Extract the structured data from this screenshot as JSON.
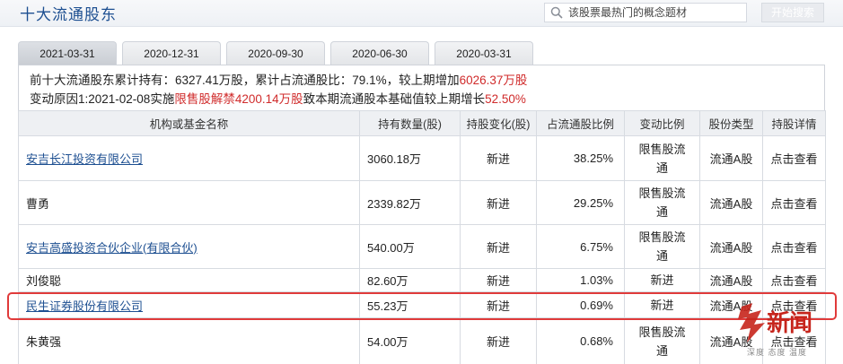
{
  "header": {
    "title": "十大流通股东",
    "search_placeholder": "该股票最热门的概念题材",
    "search_button": "开始搜索"
  },
  "tabs": [
    {
      "label": "2021-03-31",
      "active": true
    },
    {
      "label": "2020-12-31",
      "active": false
    },
    {
      "label": "2020-09-30",
      "active": false
    },
    {
      "label": "2020-06-30",
      "active": false
    },
    {
      "label": "2020-03-31",
      "active": false
    }
  ],
  "summary": {
    "line1_prefix": "前十大流通股东累计持有：6327.41万股，累计占流通股比：79.1%，较上期增加",
    "line1_value": "6026.37万股",
    "line2_prefix": "变动原因1:2021-02-08实施",
    "line2_red1": "限售股解禁4200.14万股",
    "line2_mid": "致本期流通股本基础值较上期增长",
    "line2_red2": "52.50%"
  },
  "table": {
    "headers": [
      "机构或基金名称",
      "持有数量(股)",
      "持股变化(股)",
      "占流通股比例",
      "变动比例",
      "股份类型",
      "持股详情"
    ],
    "rows": [
      {
        "name": "安吉长江投资有限公司",
        "link": true,
        "amount": "3060.18万",
        "change": "新进",
        "ratio": "38.25%",
        "reason": "限售股流通",
        "type": "流通A股",
        "detail": "点击查看"
      },
      {
        "name": "曹勇",
        "link": false,
        "amount": "2339.82万",
        "change": "新进",
        "ratio": "29.25%",
        "reason": "限售股流通",
        "type": "流通A股",
        "detail": "点击查看"
      },
      {
        "name": "安吉高盛投资合伙企业(有限合伙)",
        "link": true,
        "amount": "540.00万",
        "change": "新进",
        "ratio": "6.75%",
        "reason": "限售股流通",
        "type": "流通A股",
        "detail": "点击查看"
      },
      {
        "name": "刘俊聪",
        "link": false,
        "amount": "82.60万",
        "change": "新进",
        "ratio": "1.03%",
        "reason": "新进",
        "type": "流通A股",
        "detail": "点击查看"
      },
      {
        "name": "民生证券股份有限公司",
        "link": true,
        "amount": "55.23万",
        "change": "新进",
        "ratio": "0.69%",
        "reason": "新进",
        "type": "流通A股",
        "detail": "点击查看"
      },
      {
        "name": "朱黄强",
        "link": false,
        "amount": "54.00万",
        "change": "新进",
        "ratio": "0.68%",
        "reason": "限售股流通",
        "type": "流通A股",
        "detail": "点击查看"
      }
    ]
  },
  "watermark": {
    "text": "新闻",
    "sub": "深度 态度 温度"
  },
  "colors": {
    "accent_red": "#d02b2b",
    "link_blue": "#1d4f91",
    "highlight": "#e03a3a"
  }
}
